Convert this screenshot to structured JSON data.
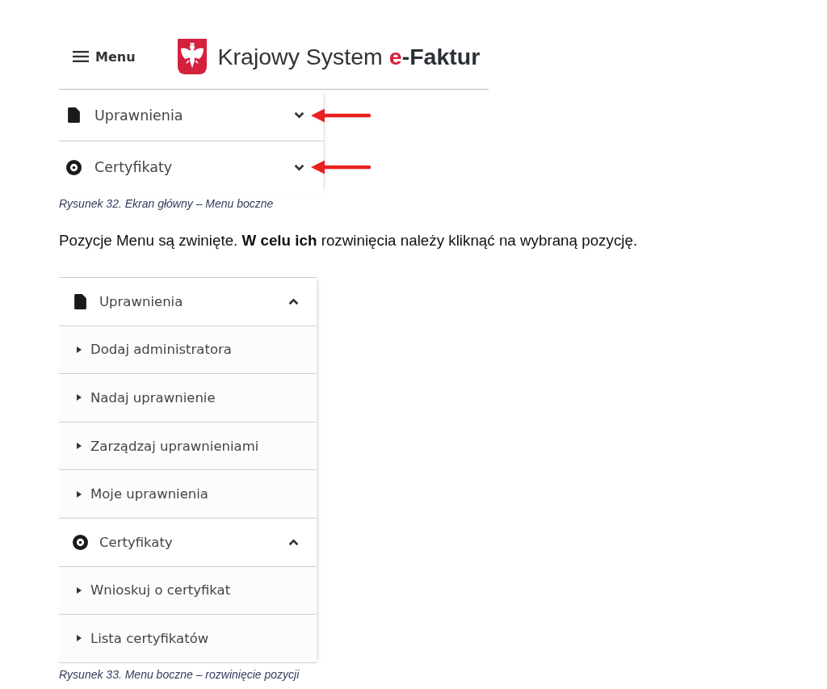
{
  "figure_1": {
    "header": {
      "menu_button": "Menu",
      "title": {
        "name": "Krajowy System",
        "brand_accent": "e",
        "brand_rest": "-Faktur"
      }
    },
    "menu": [
      {
        "kind": "document",
        "label": "Uprawnienia",
        "expanded": false,
        "marked": true
      },
      {
        "kind": "disc",
        "label": "Certyfikaty",
        "expanded": false,
        "marked": true
      }
    ],
    "caption": "Rysunek 32. Ekran główny – Menu boczne"
  },
  "paragraph": "Pozycje Menu są zwinięte. **W celu ich** rozwinięcia należy kliknąć na wybraną pozycję.",
  "figure_2": {
    "menu": [
      {
        "kind": "document",
        "label": "Uprawnienia",
        "expanded": true,
        "children": [
          {
            "label": "Dodaj administratora"
          },
          {
            "label": "Nadaj uprawnienie"
          },
          {
            "label": "Zarządzaj uprawnieniami"
          },
          {
            "label": "Moje uprawnienia"
          }
        ]
      },
      {
        "kind": "disc",
        "label": "Certyfikaty",
        "expanded": true,
        "children": [
          {
            "label": "Wnioskuj o certyfikat"
          },
          {
            "label": "Lista certyfikatów"
          }
        ]
      }
    ],
    "caption": "Rysunek 33. Menu boczne – rozwinięcie pozycji"
  }
}
